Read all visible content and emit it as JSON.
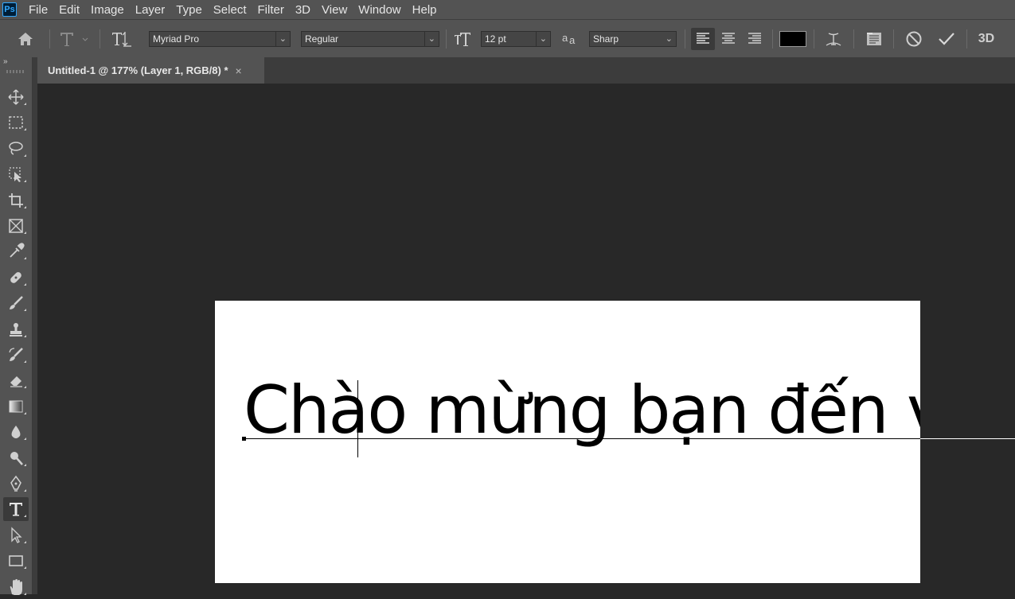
{
  "app": {
    "logo_text": "Ps"
  },
  "menu": [
    "File",
    "Edit",
    "Image",
    "Layer",
    "Type",
    "Select",
    "Filter",
    "3D",
    "View",
    "Window",
    "Help"
  ],
  "options": {
    "font_family": "Myriad Pro",
    "font_style": "Regular",
    "font_size": "12 pt",
    "antialias": "Sharp",
    "threed_label": "3D",
    "text_color": "#000000"
  },
  "document_tab": {
    "title": "Untitled-1 @ 177% (Layer 1, RGB/8) *",
    "close_glyph": "×"
  },
  "canvas": {
    "text": "Chào mừng bạn đến vớ"
  },
  "tools": [
    "move-tool",
    "rectangular-marquee-tool",
    "lasso-tool",
    "object-selection-tool",
    "crop-tool",
    "frame-tool",
    "eyedropper-tool",
    "spot-healing-brush-tool",
    "brush-tool",
    "clone-stamp-tool",
    "history-brush-tool",
    "eraser-tool",
    "gradient-tool",
    "blur-tool",
    "dodge-tool",
    "pen-tool",
    "type-tool",
    "path-selection-tool",
    "rectangle-tool",
    "hand-tool"
  ],
  "colors": {
    "accent": "#31a8ff",
    "panel": "#535353",
    "workspace": "#282828"
  }
}
